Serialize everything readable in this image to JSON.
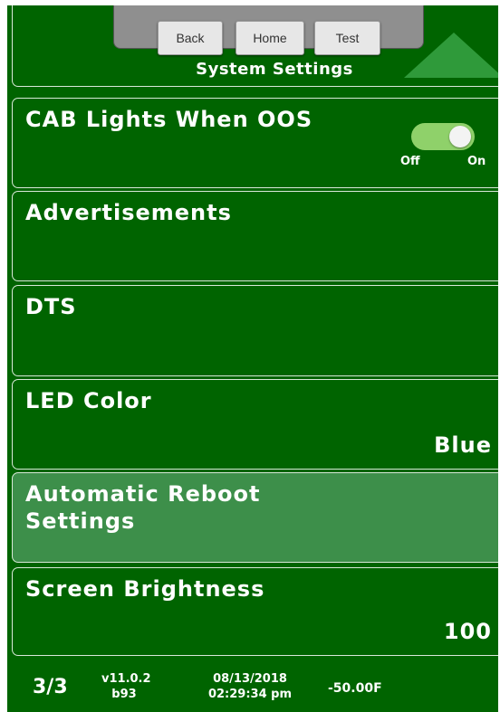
{
  "nav": {
    "back_label": "Back",
    "home_label": "Home",
    "test_label": "Test"
  },
  "header": {
    "title": "System Settings"
  },
  "settings": [
    {
      "label": "CAB Lights When OOS",
      "toggle": {
        "off_label": "Off",
        "on_label": "On",
        "state": "on"
      }
    },
    {
      "label": "Advertisements"
    },
    {
      "label": "DTS"
    },
    {
      "label": "LED Color",
      "value": "Blue"
    },
    {
      "label_line1": "Automatic Reboot",
      "label_line2": "Settings",
      "selected": true
    },
    {
      "label": "Screen Brightness",
      "value": "100"
    }
  ],
  "footer": {
    "page": "3/3",
    "version": "v11.0.2",
    "build": "b93",
    "date": "08/13/2018",
    "time": "02:29:34 pm",
    "temperature": "-50.00F"
  },
  "colors": {
    "background": "#006400",
    "selected_row": "#3d8f4a",
    "toggle_on": "#8fd16a",
    "scroll_arrow": "#2f9a3a"
  }
}
